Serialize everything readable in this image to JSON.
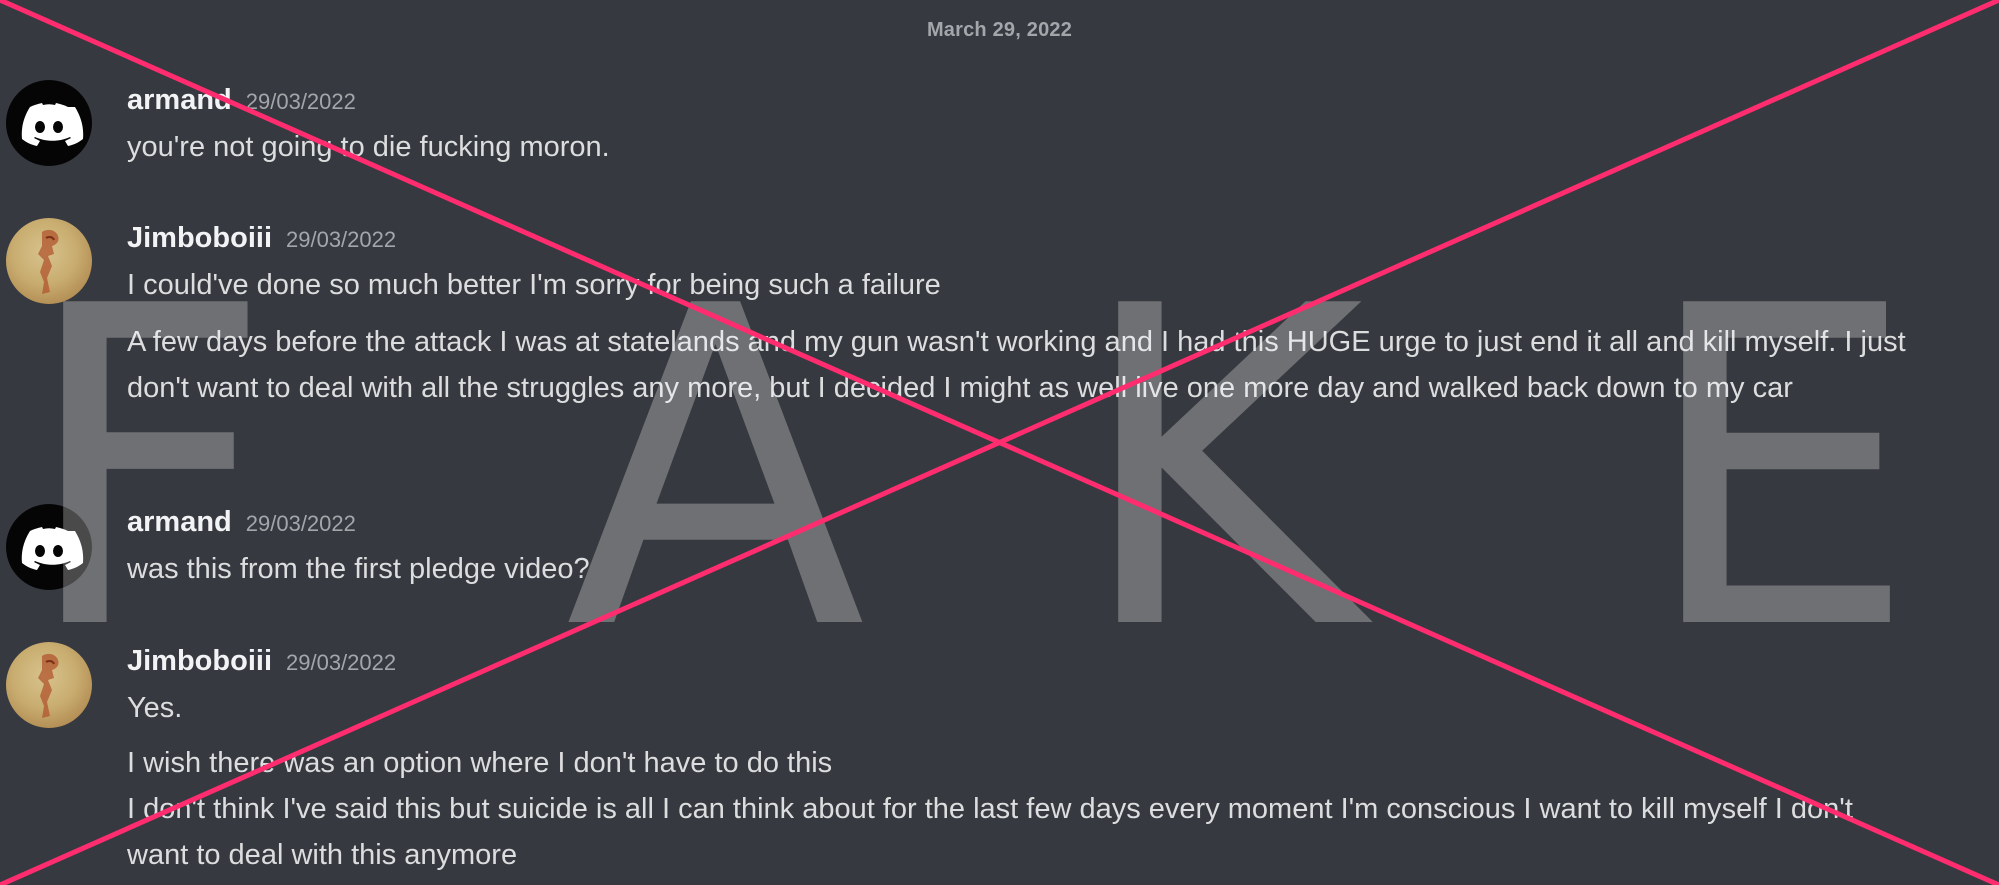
{
  "date_divider": "March 29, 2022",
  "messages": [
    {
      "username": "armand",
      "timestamp": "29/03/2022",
      "avatar": "discord-logo-icon",
      "lines": [
        "you're not going to die fucking moron."
      ]
    },
    {
      "username": "Jimboboiii",
      "timestamp": "29/03/2022",
      "avatar": "user-avatar",
      "lines": [
        "I could've done so much better I'm sorry for being such a failure",
        "A few days before the attack I was at statelands and my gun wasn't working and I had this HUGE urge to just end it all and kill myself. I just don't want to deal with all the struggles any more, but I decided I might as well live one more day and walked back down to my car"
      ]
    },
    {
      "username": "armand",
      "timestamp": "29/03/2022",
      "avatar": "discord-logo-icon",
      "lines": [
        "was this from the first pledge video?"
      ]
    },
    {
      "username": "Jimboboiii",
      "timestamp": "29/03/2022",
      "avatar": "user-avatar",
      "lines": [
        "Yes.",
        "I wish there was an option where I don't have to do this",
        "I don't think I've said this but suicide is all I can think about for the last few days every moment I'm conscious I want to kill myself I don't want to deal with this anymore"
      ]
    }
  ],
  "watermark": {
    "letters": [
      "F",
      "A",
      "K",
      "E"
    ],
    "cross_color": "#ff2d6f"
  }
}
